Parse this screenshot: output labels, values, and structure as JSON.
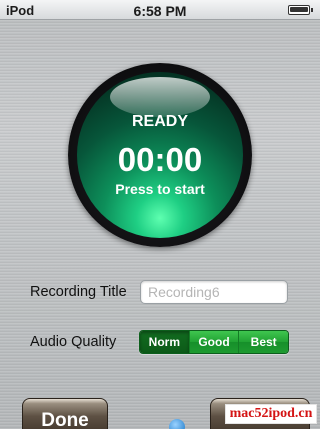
{
  "status_bar": {
    "carrier": "iPod",
    "time": "6:58 PM",
    "battery_level": 0.9
  },
  "recorder": {
    "status": "READY",
    "timer": "00:00",
    "hint": "Press to start"
  },
  "form": {
    "title_label": "Recording Title",
    "title_placeholder": "Recording6",
    "quality_label": "Audio Quality",
    "quality_options": [
      "Norm",
      "Good",
      "Best"
    ],
    "quality_selected": "Norm"
  },
  "bottom": {
    "done_label": "Done"
  },
  "watermark": "mac52ipod.cn",
  "colors": {
    "record_glow": "#1fcf84",
    "segment_green": "#21a233",
    "segment_selected": "#0c5a18",
    "watermark_red": "#d41414"
  }
}
